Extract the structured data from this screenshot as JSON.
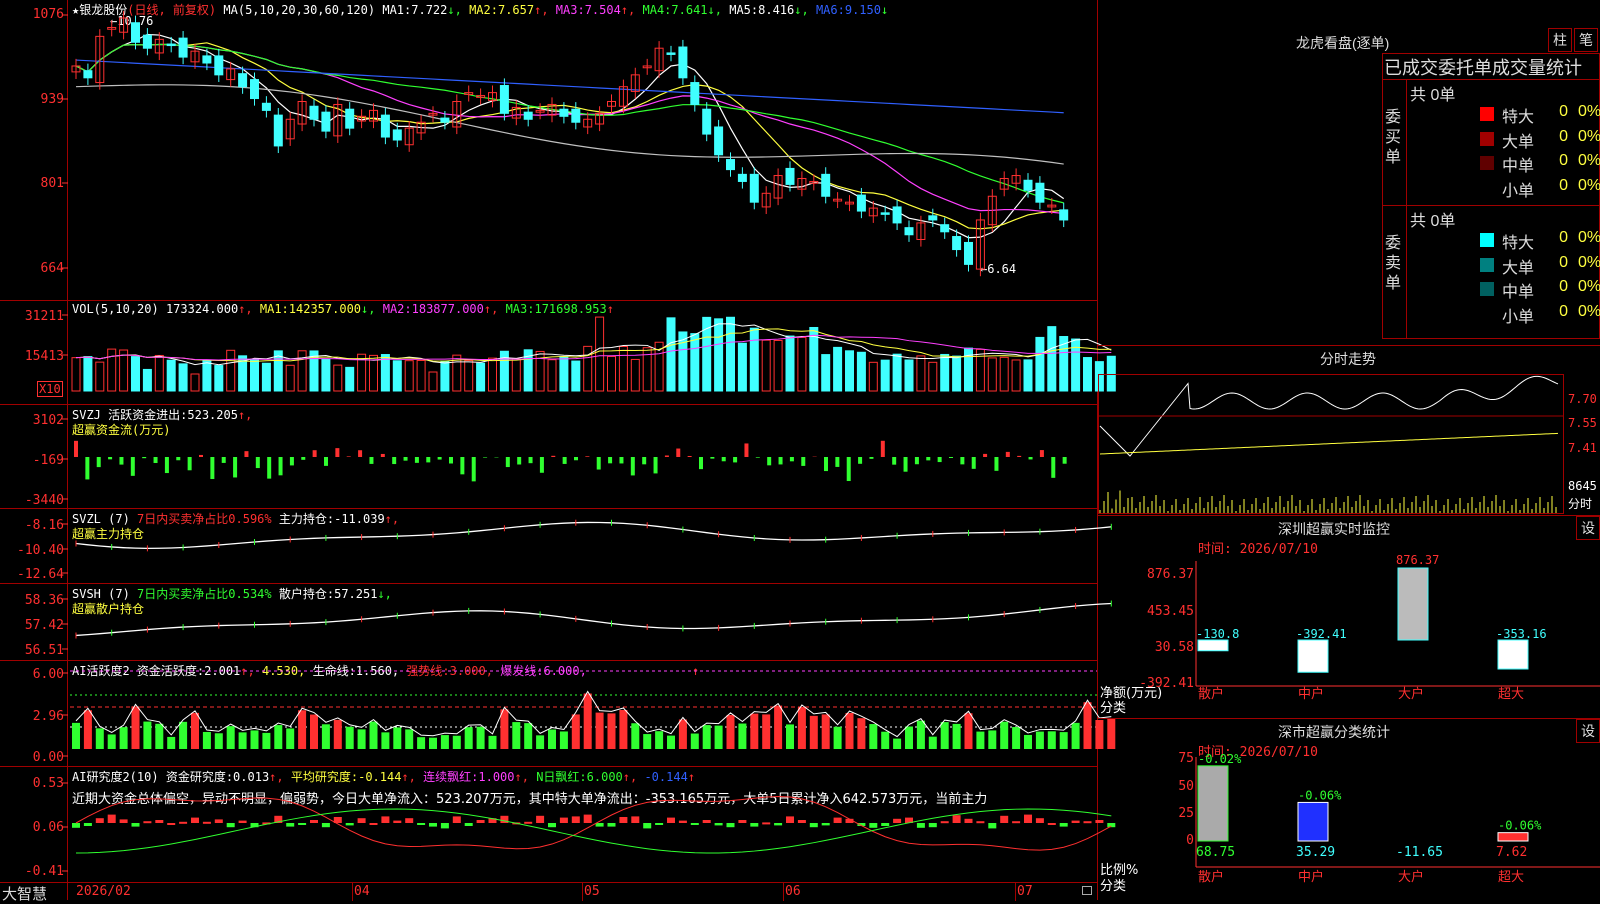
{
  "colors": {
    "up": "#ff3030",
    "down": "#40ffff",
    "ma1": "#ffffff",
    "ma2": "#ffff40",
    "ma3": "#ff40ff",
    "ma4": "#30ff30",
    "ma5": "#c0c0c0",
    "ma6": "#3060ff",
    "frame": "#a00000"
  },
  "main": {
    "star_icon": "★",
    "title": "银龙股份",
    "mode": "(日线, 前复权)",
    "ma_spec": "MA(5,10,20,30,60,120)",
    "ma1_label": "MA1:",
    "ma1_val": "7.722",
    "ma1_arrow": "↓,",
    "ma2_label": "MA2:",
    "ma2_val": "7.657",
    "ma2_arrow": "↑,",
    "ma3_label": "MA3:",
    "ma3_val": "7.504",
    "ma3_arrow": "↑,",
    "ma4_label": "MA4:",
    "ma4_val": "7.641",
    "ma4_arrow": "↓,",
    "ma5_label": "MA5:",
    "ma5_val": "8.416",
    "ma5_arrow": "↓,",
    "ma6_label": "MA6:",
    "ma6_val": "9.150",
    "ma6_arrow": "↓",
    "hi_label": "10.76",
    "lo_label": "6.64",
    "yticks": [
      "1076",
      "939",
      "801",
      "664"
    ],
    "close": [
      9.95,
      9.75,
      10.45,
      10.6,
      10.76,
      10.35,
      10.25,
      10.4,
      10.3,
      10.1,
      10.2,
      10.0,
      9.8,
      9.9,
      9.6,
      9.4,
      9.2,
      8.6,
      9.05,
      9.35,
      9.05,
      8.85,
      9.3,
      8.9,
      9.1,
      9.2,
      8.75,
      8.7,
      8.9,
      9.0,
      9.15,
      9.0,
      9.35,
      9.5,
      9.45,
      9.5,
      9.15,
      9.25,
      9.05,
      9.2,
      9.3,
      9.1,
      9.0,
      9.05,
      9.15,
      9.35,
      9.6,
      9.8,
      9.95,
      10.25,
      10.15,
      9.75,
      9.3,
      8.8,
      8.45,
      8.2,
      8.0,
      7.65,
      7.8,
      8.1,
      7.95,
      8.05,
      8.0,
      7.75,
      7.7,
      7.65,
      7.5,
      7.55,
      7.45,
      7.3,
      7.1,
      7.3,
      7.35,
      7.15,
      6.85,
      6.6,
      7.35,
      7.75,
      8.05,
      8.1,
      7.85,
      7.65,
      7.6,
      7.35
    ]
  },
  "vol": {
    "label": "VOL(5,10,20)",
    "val": "173324.000",
    "arrow": "↑,",
    "ma1_label": "MA1:",
    "ma1": "142357.000",
    "ma1_arrow": "↓,",
    "ma2_label": "MA2:",
    "ma2": "183877.000",
    "ma2_arrow": "↑,",
    "ma3_label": "MA3:",
    "ma3": "171698.953",
    "ma3_arrow": "↑",
    "yticks": [
      "31211",
      "15413"
    ],
    "unit": "X10",
    "values": [
      17.1,
      17.65,
      14.81,
      21.49,
      21.02,
      17.65,
      11.06,
      18.22,
      15.78,
      13.92,
      8.72,
      15.79,
      13.05,
      20.87,
      18.04,
      16.26,
      14.23,
      20.58,
      13.18,
      20.62,
      20.54,
      16.23,
      13.28,
      12.12,
      18.86,
      18.26,
      18.7,
      15.5,
      15.55,
      15.65,
      9.74,
      15.27,
      18.39,
      15.61,
      14.27,
      16.86,
      20.38,
      16.49,
      21.13,
      20.29,
      16.03,
      17.61,
      15.36,
      22.89,
      37.91,
      17.71,
      22.82,
      16.19,
      22.2,
      25.0,
      37.52,
      30.28,
      29.43,
      37.76,
      37.01,
      37.81,
      24.5,
      32.21,
      26.06,
      25.91,
      28.18,
      27.48,
      32.57,
      18.67,
      22.37,
      20.61,
      19.86,
      14.71,
      15.82,
      18.88,
      15.9,
      18.01,
      14.71,
      18.74,
      17.9,
      22.0,
      21.34,
      16.96,
      17.27,
      15.91,
      15.96,
      27.48,
      33.01,
      27.94,
      26.66,
      17.16,
      15.06,
      17.81
    ]
  },
  "svzj": {
    "label": "SVZJ",
    "val_label": "活跃资金进出:",
    "val": "523.205",
    "arrow": "↑,",
    "title": "超赢资金流(万元)",
    "yticks": [
      "3102",
      "-169",
      "-3440"
    ],
    "values": [
      26.94,
      -37.37,
      -16.85,
      -3.9,
      -12.66,
      -31.43,
      -1.98,
      -10.01,
      -26.75,
      -5.42,
      -22.14,
      3.41,
      -36.71,
      -9.88,
      -34.11,
      9.75,
      -18.44,
      -36.03,
      -30.54,
      -14.04,
      -4.71,
      11.32,
      -14.81,
      14.79,
      1.0,
      11.29,
      -11.51,
      5.09,
      -11.75,
      -6.09,
      -9.77,
      -9.0,
      -4.27,
      -10.82,
      -28.89,
      -40.61,
      -0.92,
      -0.64,
      -16.78,
      -12.49,
      -10.29,
      -26.29,
      1.99,
      -11.57,
      -5.43,
      1.14,
      -20.89,
      -10.55,
      -10.75,
      -30.71,
      -12.2,
      -27.37,
      2.54,
      14.11,
      1.69,
      -20.22,
      -2.71,
      -7.12,
      -9.01,
      22.58,
      -1.08,
      -13.88,
      -12.39,
      -7.2,
      -14.86,
      0.54,
      -23.44,
      -16.55,
      -40.04,
      -11.33,
      -3.06,
      27.03,
      -12.77,
      -24.5,
      -12.06,
      -5.61,
      -8.45,
      -1.63,
      -12.27,
      -19.74,
      5.17,
      -23.05,
      8.52,
      1.86,
      -4.09,
      11.54,
      -34.73,
      -11.2
    ]
  },
  "svzl": {
    "label": "SVZL (7)",
    "pct_label": "7日内买卖净占比",
    "pct": "0.596%",
    "hold_label": "主力持仓:",
    "hold": "-11.039",
    "arrow": "↑,",
    "title": "超赢主力持仓",
    "yticks": [
      "-8.16",
      "-10.40",
      "-12.64"
    ]
  },
  "svsh": {
    "label": "SVSH (7)",
    "pct_label": "7日内买卖净占比",
    "pct": "0.534%",
    "hold_label": "散户持仓:",
    "hold": "57.251",
    "arrow": "↓,",
    "title": "超赢散户持仓",
    "yticks": [
      "58.36",
      "57.42",
      "56.51"
    ]
  },
  "ai1": {
    "label": "AI活跃度2",
    "act_label": "资金活跃度:",
    "act": "2.001",
    "act_arrow": "↑,",
    "v2": "4.530",
    "v2_sep": ",",
    "life_label": "生命线:",
    "life": "1.560",
    "life_sep": ",",
    "strong_label": "强势线:",
    "strong": "3.000",
    "strong_sep": ",",
    "burst_label": "爆发线:",
    "burst": "6.000",
    "burst_sep": ",",
    "burst_arrow": "↑",
    "yticks": [
      "6.00",
      "2.96",
      "0.00"
    ],
    "values": [
      2.01,
      2.98,
      1.59,
      1.12,
      1.68,
      3.28,
      2.11,
      1.94,
      0.93,
      2.09,
      2.78,
      1.31,
      1.21,
      1.76,
      1.28,
      1.43,
      1.24,
      1.84,
      1.58,
      2.98,
      2.65,
      1.9,
      2.24,
      1.71,
      1.51,
      2.11,
      1.28,
      1.66,
      1.51,
      0.91,
      0.87,
      1.07,
      1.02,
      1.68,
      1.71,
      1.01,
      3.05,
      2.07,
      1.99,
      1.05,
      1.5,
      1.35,
      2.66,
      4.27,
      2.8,
      2.74,
      3.0,
      1.98,
      1.15,
      1.37,
      1.03,
      2.27,
      1.19,
      1.84,
      1.8,
      2.62,
      1.96,
      2.72,
      2.66,
      3.34,
      1.89,
      3.23,
      2.55,
      2.66,
      1.71,
      2.77,
      2.37,
      1.92,
      1.33,
      0.8,
      1.73,
      2.18,
      0.95,
      2.07,
      1.93,
      2.75,
      1.34,
      1.43,
      2.1,
      1.69,
      1.08,
      1.34,
      1.36,
      1.3,
      2.01,
      3.6,
      2.23,
      2.34
    ]
  },
  "ai2": {
    "label": "AI研究度2(10)",
    "res_label": "资金研究度:",
    "res": "0.013",
    "res_arrow": "↑,",
    "avg_label": "平均研究度:",
    "avg": "-0.144",
    "avg_arrow": "↑,",
    "red_label": "连续飘红:",
    "red": "1.000",
    "red_arrow": "↑,",
    "nred_label": "N日飘红:",
    "nred": "6.000",
    "nred_arrow": "↑,",
    "last": "-0.144",
    "last_arrow": "↑",
    "summary": "近期大资金总体偏空，异动不明显，偏弱势，今日大单净流入：523.207万元，其中特大单净流出：-353.165万元，大单5日累计净入642.573万元，当前主力",
    "yticks": [
      "0.53",
      "0.06",
      "-0.41"
    ],
    "values": [
      -0.08,
      -0.05,
      0.08,
      0.14,
      0.06,
      -0.06,
      0.03,
      0.05,
      0.0,
      0.02,
      0.09,
      0.02,
      0.06,
      -0.07,
      0.04,
      -0.07,
      0.01,
      0.12,
      -0.06,
      -0.03,
      0.05,
      -0.07,
      0.1,
      -0.04,
      0.08,
      0.0,
      0.11,
      0.04,
      0.08,
      -0.02,
      -0.06,
      -0.09,
      0.11,
      -0.05,
      0.05,
      0.08,
      0.12,
      0.01,
      0.02,
      0.12,
      -0.07,
      0.09,
      0.11,
      0.14,
      -0.06,
      -0.06,
      0.1,
      0.11,
      -0.09,
      -0.02,
      0.09,
      0.04,
      -0.01,
      0.05,
      -0.04,
      -0.07,
      0.05,
      -0.06,
      0.01,
      -0.04,
      0.11,
      0.05,
      -0.07,
      -0.04,
      0.09,
      0.07,
      -0.05,
      -0.08,
      -0.05,
      0.07,
      0.09,
      -0.08,
      -0.07,
      0.03,
      0.13,
      0.07,
      0.03,
      -0.09,
      0.12,
      0.03,
      0.14,
      0.08,
      0.0,
      -0.06,
      0.04,
      0.03,
      0.05,
      -0.07
    ]
  },
  "xaxis": {
    "labels": [
      "2026/02",
      "04",
      "05",
      "06",
      "07"
    ]
  },
  "brand": "大智慧",
  "lhb": {
    "title": "龙虎看盘(逐单)",
    "btn1": "柱",
    "btn2": "笔",
    "subtitle": "已成交委托单成交量统计",
    "buy": {
      "side": "委买单",
      "total": "共 0单",
      "rows": [
        {
          "name": "特大",
          "val": "0",
          "pct": "0%",
          "color": "#ff0000"
        },
        {
          "name": "大单",
          "val": "0",
          "pct": "0%",
          "color": "#a00000"
        },
        {
          "name": "中单",
          "val": "0",
          "pct": "0%",
          "color": "#600000"
        },
        {
          "name": "小单",
          "val": "0",
          "pct": "0%",
          "color": "#000000"
        }
      ]
    },
    "sell": {
      "side": "委卖单",
      "total": "共 0单",
      "rows": [
        {
          "name": "特大",
          "val": "0",
          "pct": "0%",
          "color": "#00ffff"
        },
        {
          "name": "大单",
          "val": "0",
          "pct": "0%",
          "color": "#008080"
        },
        {
          "name": "中单",
          "val": "0",
          "pct": "0%",
          "color": "#006060"
        },
        {
          "name": "小单",
          "val": "0",
          "pct": "0%",
          "color": "#000000"
        }
      ]
    }
  },
  "intraday": {
    "title": "分时走势",
    "yticks": [
      "7.70",
      "7.55",
      "7.41"
    ],
    "vol_label": "8645",
    "unit": "分时"
  },
  "sz_monitor": {
    "title": "深圳超赢实时监控",
    "btn": "设",
    "time": "时间: 2026/07/10",
    "yticks": [
      "876.37",
      "453.45",
      "30.58",
      "-392.41"
    ],
    "ylabel": "净额(万元)",
    "cat_label": "分类",
    "categories": [
      "散户",
      "中户",
      "大户",
      "超大"
    ],
    "values": [
      -130.8,
      -392.41,
      876.37,
      -353.16
    ],
    "labels": [
      "-130.8",
      "-392.41",
      "876.37",
      "-353.16"
    ]
  },
  "sh_stats": {
    "title": "深市超赢分类统计",
    "btn": "设",
    "time": "时间: 2026/07/10",
    "yticks": [
      "75",
      "50",
      "25",
      "0"
    ],
    "ylabel": "比例%",
    "cat_label": "分类",
    "categories": [
      "散户",
      "中户",
      "大户",
      "超大"
    ],
    "values": [
      68.75,
      35.29,
      -11.65,
      7.62
    ],
    "labels": [
      "68.75",
      "35.29",
      "-11.65",
      "7.62"
    ],
    "changes": [
      "-0.02%",
      "-0.06%",
      "",
      "-0.06%"
    ]
  }
}
